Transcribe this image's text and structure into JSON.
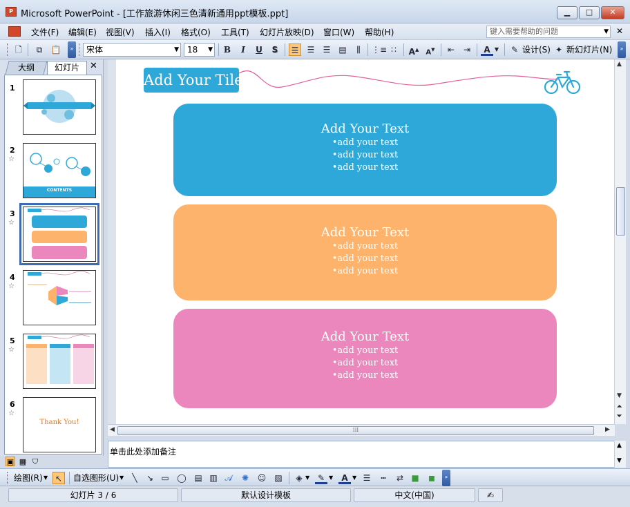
{
  "window": {
    "app_icon": "powerpoint-icon",
    "title": "Microsoft PowerPoint - [工作旅游休闲三色清新通用ppt模板.ppt]",
    "controls": {
      "minimize": "▁",
      "maximize": "□",
      "close": "✕"
    }
  },
  "menu": {
    "items": [
      "文件(F)",
      "编辑(E)",
      "视图(V)",
      "插入(I)",
      "格式(O)",
      "工具(T)",
      "幻灯片放映(D)",
      "窗口(W)",
      "帮助(H)"
    ],
    "help_placeholder": "键入需要帮助的问题",
    "doc_close": "✕"
  },
  "toolbar": {
    "font_name": "宋体",
    "font_size": "18",
    "bold": "B",
    "italic": "I",
    "underline": "U",
    "shadow": "S",
    "design_label": "设计(S)",
    "new_slide_label": "新幻灯片(N)"
  },
  "left_pane": {
    "tab_outline": "大纲",
    "tab_slides": "幻灯片",
    "close": "✕",
    "thumbnails": [
      {
        "num": "1",
        "has_star": false
      },
      {
        "num": "2",
        "has_star": true,
        "caption": "CONTENTS"
      },
      {
        "num": "3",
        "has_star": true,
        "selected": true
      },
      {
        "num": "4",
        "has_star": true
      },
      {
        "num": "5",
        "has_star": true
      },
      {
        "num": "6",
        "has_star": true,
        "caption": "Thank You!"
      }
    ],
    "star_glyph": "☆"
  },
  "slide": {
    "title": "Add Your Tile",
    "panels": [
      {
        "title": "Add Your Text",
        "lines": [
          "•add your text",
          "•add your text",
          "•add your text"
        ],
        "color": "#2ea8d8"
      },
      {
        "title": "Add Your Text",
        "lines": [
          "•add your text",
          "•add your text",
          "•add your text"
        ],
        "color": "#fdb36c"
      },
      {
        "title": "Add Your Text",
        "lines": [
          "•add your text",
          "•add your text",
          "•add your text"
        ],
        "color": "#ec87bd"
      }
    ],
    "wave_color": "#e0609a",
    "bike_color": "#2ea8d8"
  },
  "notes": {
    "placeholder": "单击此处添加备注"
  },
  "drawbar": {
    "draw_label": "绘图(R)",
    "autoshapes_label": "自选图形(U)"
  },
  "status": {
    "slide_info": "幻灯片 3 / 6",
    "template": "默认设计模板",
    "language": "中文(中国)"
  }
}
